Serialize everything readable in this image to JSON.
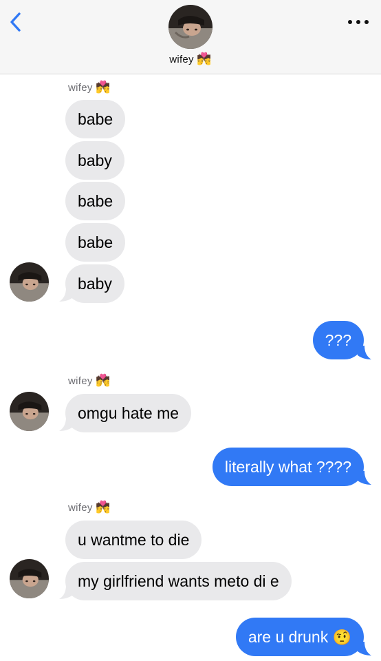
{
  "header": {
    "back_icon": "chevron-left-icon",
    "contact_name": "wifey",
    "contact_emoji": "💏",
    "more_icon": "ellipsis-icon"
  },
  "colors": {
    "accent": "#3179f5",
    "incoming_bubble": "#e9e9eb",
    "header_bg": "#f6f6f6"
  },
  "messages": {
    "group1_sender": "wifey",
    "group1_sender_emoji": "💏",
    "m1": "babe",
    "m2": "baby",
    "m3": "babe",
    "m4": "babe",
    "m5": "baby",
    "m6": "???",
    "group2_sender": "wifey",
    "group2_sender_emoji": "💏",
    "m7": "omgu hate me",
    "m8": "literally what ????",
    "group3_sender": "wifey",
    "group3_sender_emoji": "💏",
    "m9": "u wantme to die",
    "m10": "my girlfriend wants meto di e",
    "m11": "are u drunk",
    "m11_emoji": "🤨"
  }
}
